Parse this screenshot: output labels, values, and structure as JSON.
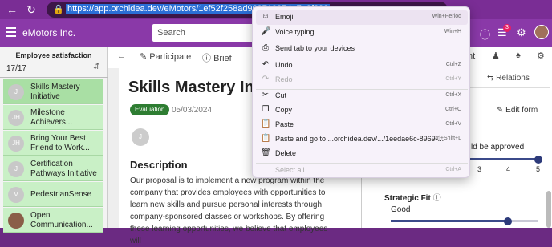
{
  "browser": {
    "url": "https://app.orchidea.dev/eMotors/1ef52f258ad969719974e7a9f399",
    "lock_icon": "lock-icon"
  },
  "app": {
    "name": "eMotors Inc.",
    "search_placeholder": "Search",
    "notification_count": "3"
  },
  "left_panel": {
    "title": "Employee satisfaction",
    "count": "17/17",
    "items": [
      {
        "initials": "J",
        "label": "Skills Mastery Initiative"
      },
      {
        "initials": "JH",
        "label": "Milestone Achievers..."
      },
      {
        "initials": "JH",
        "label": "Bring Your Best Friend to Work..."
      },
      {
        "initials": "J",
        "label": "Certification Pathways Initiative"
      },
      {
        "initials": "V",
        "label": "PedestrianSense"
      },
      {
        "initials": "",
        "label": "Open Communication..."
      }
    ]
  },
  "main": {
    "toolbar": {
      "participate": "Participate",
      "brief": "Brief"
    },
    "title": "Skills Mastery Initiative",
    "badge": "Evaluation",
    "date": "05/03/2024",
    "avatar_initial": "J",
    "description_heading": "Description",
    "description_body": "Our proposal is to implement a new program within the company that provides employees with opportunities to learn new skills and pursue personal interests through company-sponsored classes or workshops. By offering these learning opportunities, we believe that employees will"
  },
  "right_panel": {
    "tab_partial": "nt",
    "relations_label": "Relations",
    "edit_form_label": "Edit form",
    "approve_text": "ld be approved",
    "scale_labels": [
      "3",
      "4",
      "5"
    ],
    "approval_value": 5,
    "strategic_fit_heading": "Strategic Fit",
    "strategic_fit_value_label": "Good",
    "strategic_fit_value": 4
  },
  "context_menu": {
    "items": [
      {
        "icon": "emoji-icon",
        "label": "Emoji",
        "shortcut": "Win+Period",
        "disabled": false
      },
      {
        "icon": "microphone-icon",
        "label": "Voice typing",
        "shortcut": "Win+H",
        "disabled": false
      },
      {
        "icon": "send-tab-icon",
        "label": "Send tab to your devices",
        "shortcut": "",
        "disabled": false
      },
      {
        "icon": "undo-icon",
        "label": "Undo",
        "shortcut": "Ctrl+Z",
        "disabled": false
      },
      {
        "icon": "redo-icon",
        "label": "Redo",
        "shortcut": "Ctrl+Y",
        "disabled": true
      },
      {
        "icon": "cut-icon",
        "label": "Cut",
        "shortcut": "Ctrl+X",
        "disabled": false
      },
      {
        "icon": "copy-icon",
        "label": "Copy",
        "shortcut": "Ctrl+C",
        "disabled": false
      },
      {
        "icon": "paste-icon",
        "label": "Paste",
        "shortcut": "Ctrl+V",
        "disabled": false
      },
      {
        "icon": "paste-go-icon",
        "label": "Paste and go to ...orchidea.dev/.../1eedae6c-8969-...",
        "shortcut": "Ctrl+Shift+L",
        "disabled": false
      },
      {
        "icon": "delete-icon",
        "label": "Delete",
        "shortcut": "",
        "disabled": false
      },
      {
        "icon": "",
        "label": "Select all",
        "shortcut": "Ctrl+A",
        "disabled": true
      }
    ]
  }
}
